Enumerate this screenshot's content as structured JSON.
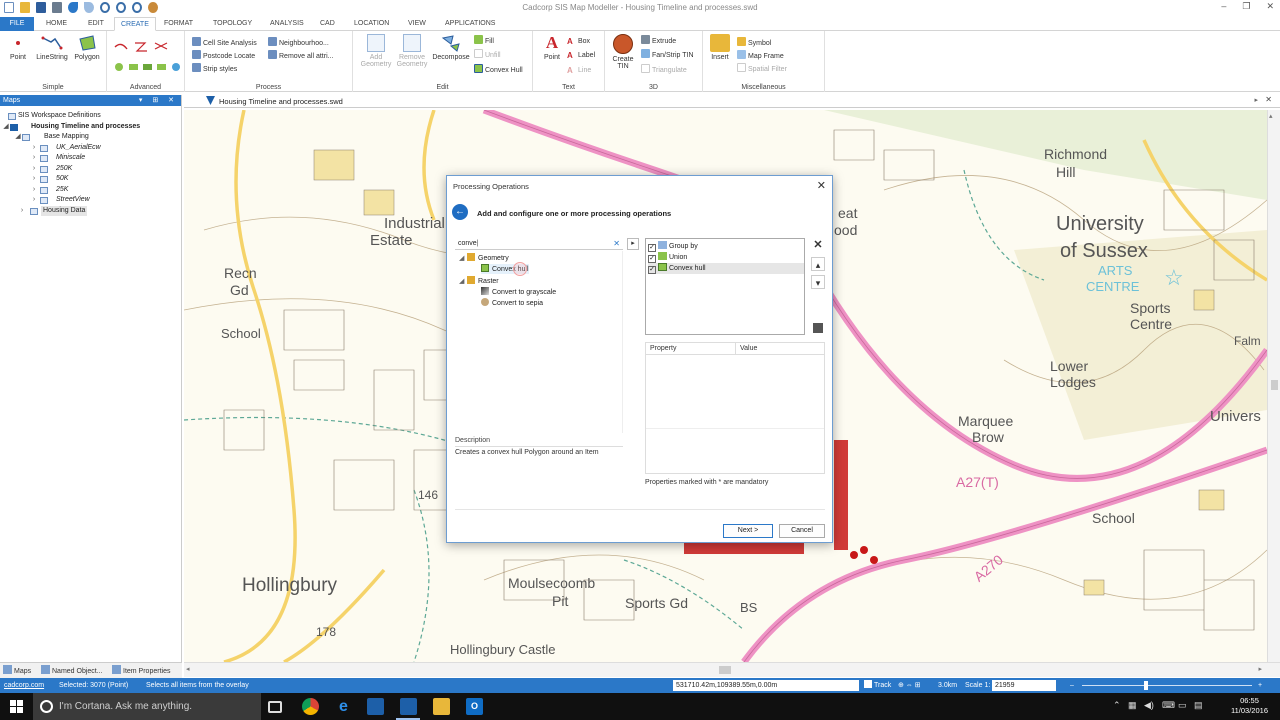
{
  "window": {
    "title": "Cadcorp SIS Map Modeller - Housing Timeline and processes.swd"
  },
  "ribbon_tabs": [
    "FILE",
    "HOME",
    "EDIT",
    "CREATE",
    "FORMAT",
    "TOPOLOGY",
    "ANALYSIS",
    "CAD",
    "LOCATION",
    "VIEW",
    "APPLICATIONS"
  ],
  "ribbon": {
    "simple": {
      "label": "Simple",
      "point": "Point",
      "linestring": "LineString",
      "polygon": "Polygon"
    },
    "advanced": {
      "label": "Advanced"
    },
    "process": {
      "label": "Process",
      "cell_site": "Cell Site Analysis",
      "postcode": "Postcode Locate",
      "strip_styles": "Strip styles",
      "neighbourhood": "Neighbourhoo...",
      "remove_all": "Remove all attri..."
    },
    "edit": {
      "label": "Edit",
      "add_geometry": "Add Geometry",
      "remove_geometry": "Remove Geometry",
      "decompose": "Decompose",
      "fill": "Fill",
      "unfill": "Unfill",
      "convex_hull": "Convex Hull"
    },
    "text": {
      "label": "Text",
      "point": "Point",
      "box": "Box",
      "label_btn": "Label",
      "line": "Line"
    },
    "threed": {
      "label": "3D",
      "create_tin": "Create TIN",
      "extrude": "Extrude",
      "fan_strip": "Fan/Strip TIN",
      "triangulate": "Triangulate"
    },
    "misc": {
      "label": "Miscellaneous",
      "insert": "Insert",
      "symbol": "Symbol",
      "map_frame": "Map Frame",
      "spatial_filter": "Spatial Filter"
    }
  },
  "left_panel": {
    "title": "Maps",
    "tree": [
      {
        "label": "SIS Workspace Definitions"
      },
      {
        "label": "Housing Timeline and processes"
      },
      {
        "label": "Base Mapping"
      },
      {
        "label": "UK_AerialEcw"
      },
      {
        "label": "Miniscale"
      },
      {
        "label": "250K"
      },
      {
        "label": "50K"
      },
      {
        "label": "25K"
      },
      {
        "label": "StreetView"
      },
      {
        "label": "Housing Data"
      }
    ],
    "bottom_tabs": [
      "Maps",
      "Named Object...",
      "Item Properties"
    ]
  },
  "document_tab": "Housing Timeline and processes.swd",
  "map_labels": {
    "industrial": "Industrial",
    "estate": "Estate",
    "recn": "Recn",
    "gd": "Gd",
    "school1": "School",
    "hollingbury": "Hollingbury",
    "moulsecoomb": "Moulsecoomb",
    "pit": "Pit",
    "sports_gd": "Sports Gd",
    "hollingbury_castle": "Hollingbury Castle",
    "richmond": "Richmond",
    "hill": "Hill",
    "university": "University",
    "of_sussex": "of Sussex",
    "arts": "ARTS",
    "centre": "CENTRE",
    "sports": "Sports",
    "centre2": "Centre",
    "lower": "Lower",
    "lodges": "Lodges",
    "marquee": "Marquee",
    "brow": "Brow",
    "a27": "A27(T)",
    "a270": "A270",
    "school2": "School",
    "univers": "Univers",
    "falm": "Falm",
    "num146": "146",
    "num178": "178",
    "bs": "BS",
    "eat": "eat",
    "ood": "ood"
  },
  "dialog": {
    "title": "Processing Operations",
    "heading": "Add and configure one or more processing operations",
    "search_value": "conve",
    "tree": {
      "geometry": "Geometry",
      "convex_hull": "Convex hull",
      "raster": "Raster",
      "grayscale": "Convert to grayscale",
      "sepia": "Convert to sepia"
    },
    "description_label": "Description",
    "description_text": "Creates a convex hull Polygon around an Item",
    "selected_ops": [
      "Group by",
      "Union",
      "Convex hull"
    ],
    "property_header": "Property",
    "value_header": "Value",
    "mandatory_note": "Properties marked with * are mandatory",
    "next_label": "Next >",
    "cancel_label": "Cancel"
  },
  "status_bar": {
    "brand": "cadcorp.com",
    "selected": "Selected: 3070 (Point)",
    "hint": "Selects all items from the overlay",
    "coords": "531710.42m,109389.55m,0.00m",
    "track": "Track",
    "scale_distance": "3.0km",
    "scale_label": "Scale 1:",
    "scale_value": "21959"
  },
  "taskbar": {
    "cortana": "I'm Cortana. Ask me anything.",
    "time": "06:55",
    "date": "11/03/2016"
  }
}
